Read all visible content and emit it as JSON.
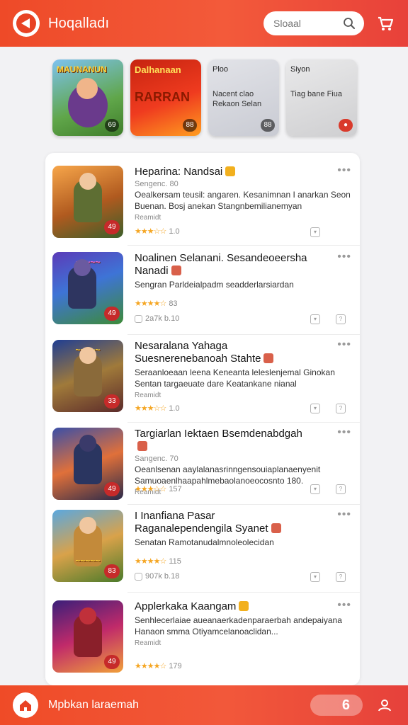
{
  "header": {
    "title": "Hoqalladı",
    "search_placeholder": "Sloaal",
    "accent": "#ee4a28"
  },
  "featured": [
    {
      "title": "MAUNANUN",
      "subtitle": "",
      "badge": "69",
      "icon": "game-art"
    },
    {
      "title": "Dalhanaan",
      "subtitle": "RARRAN",
      "badge": "88",
      "icon": "game-art"
    },
    {
      "title": "Ploo",
      "subtitle": "Nacent clao Rekaon Selan",
      "badge": "88",
      "icon": "game-art"
    },
    {
      "title": "Siyon",
      "subtitle": "Tiag bane Fiua",
      "badge": "●",
      "icon": "game-art"
    }
  ],
  "apps": [
    {
      "name": "Heparina: Nandsai",
      "publisher": "Sengenc. 80",
      "description": "Oealkersam teusil: angaren. Kesanimnan I anarkan Seon Buenan. Bosj anekan Stangnbemilianemyan",
      "meta": "Reamidt",
      "rating": "1.0",
      "stars": "★★★☆☆",
      "badge": "49"
    },
    {
      "name": "Noalinen Selanani. Sesandeoeersha Nanadi",
      "publisher": "",
      "description": "Sengran Parldeialpadm seadderlarsiardan",
      "meta": "",
      "rating": "83",
      "extra": "2a7k b.10",
      "stars": "★★★★☆",
      "badge": "49"
    },
    {
      "name": "Nesaralana Yahaga Suesnerenebanoah Stahte",
      "publisher": "",
      "description": "Seraanloeaan leena Keneanta leleslenjemal Ginokan Sentan targaeuate dare Keatankane nianal",
      "meta": "Reamidt",
      "rating": "1.0",
      "stars": "★★★☆☆",
      "badge": "33"
    },
    {
      "name": "Targiarlan Iektaen Bsemdenabdgah",
      "publisher": "Sangenc. 70",
      "description": "Oeanlsenan aaylalanasrinngensouiaplanaenyenit Samuoaenlhaapahlmebaolanoeocosnto 180.",
      "meta": "Reamidt",
      "rating": "157",
      "stars": "★★★☆☆",
      "badge": "49"
    },
    {
      "name": "I Inanfiana Pasar Raganalependengila Syanet",
      "publisher": "",
      "description": "Senatan Ramotanudalmnoleolecidan",
      "meta": "",
      "rating": "115",
      "extra": "907k b.18",
      "stars": "★★★★☆",
      "badge": "83"
    },
    {
      "name": "Applerkaka Kaangam",
      "publisher": "",
      "description": "Senhlecerlaiae aueanaerkadenparaerbah andepaiyana Hanaon smma Otiyamcelanoaclidan...",
      "meta": "Reamidt",
      "rating": "179",
      "stars": "★★★★☆",
      "badge": "49"
    }
  ],
  "bottom": {
    "label": "Mpbkan laraemah",
    "counter": "6"
  }
}
